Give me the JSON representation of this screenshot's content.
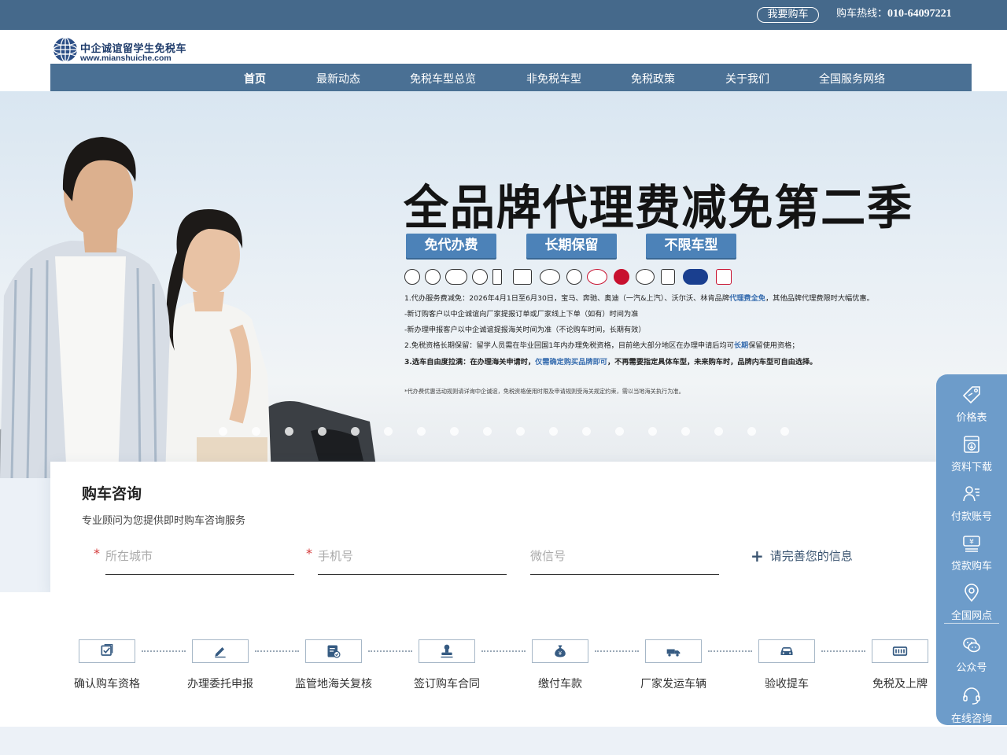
{
  "topbar": {
    "buy_label": "我要购车",
    "hotline_prefix": "购车热线：",
    "hotline_number": "010-64097221"
  },
  "logo": {
    "name": "中企诚谊留学生免税车",
    "url": "www.mianshuiche.com"
  },
  "nav": {
    "items": [
      {
        "label": "首页",
        "active": true
      },
      {
        "label": "最新动态"
      },
      {
        "label": "免税车型总览"
      },
      {
        "label": "非免税车型"
      },
      {
        "label": "免税政策"
      },
      {
        "label": "关于我们"
      },
      {
        "label": "全国服务网络"
      }
    ]
  },
  "banner": {
    "title": "全品牌代理费减免第二季",
    "tags": [
      "免代办费",
      "长期保留",
      "不限车型"
    ],
    "lines": [
      {
        "pre": "1.代办服务费减免：2026年4月1日至6月30日，宝马、奔驰、奥迪（一汽&上汽）、沃尔沃、林肯品牌",
        "em": "代理费全免",
        "post": "，其他品牌代理费限时大幅优惠。"
      },
      {
        "pre": "-新订购客户以中企诚谊向厂家提报订单或厂家线上下单（如有）时间为准",
        "em": "",
        "post": ""
      },
      {
        "pre": "-新办理申报客户以中企诚谊提报海关时间为准（不论购车时间，长期有效）",
        "em": "",
        "post": ""
      },
      {
        "pre": "2.免税资格长期保留：留学人员需在毕业回国1年内办理免税资格，目前绝大部分地区在办理申请后均可",
        "em": "长期",
        "post": "保留使用资格；"
      },
      {
        "pre": "3.选车自由度拉满：在办理海关申请时，",
        "em": "仅需确定购买品牌即可",
        "post": "，不再需要指定具体车型，未来购车时，品牌内车型可自由选择。"
      }
    ],
    "note": "*代办费优惠活动规则请详询中企诚谊，免税资格使用时限及申请规则受海关规定约束，需以当地海关执行为准。",
    "brand_icons": [
      "bmw-icon",
      "mercedes-icon",
      "audi-icon",
      "volvo-icon",
      "lincoln-icon",
      "cadillac-icon",
      "infiniti-icon",
      "volkswagen-icon",
      "toyota-icon",
      "mg-icon",
      "mazda-icon",
      "lexus-icon",
      "ford-icon",
      "honda-icon"
    ],
    "slide_count": 18,
    "active_slide": 0
  },
  "consult": {
    "title": "购车咨询",
    "subtitle": "专业顾问为您提供即时购车咨询服务",
    "city_placeholder": "所在城市",
    "phone_placeholder": "手机号",
    "wechat_placeholder": "微信号",
    "more_label": "请完善您的信息",
    "required_mark": "*"
  },
  "process": {
    "steps": [
      {
        "label": "确认购车资格",
        "icon": "checklist-icon"
      },
      {
        "label": "办理委托申报",
        "icon": "pen-icon"
      },
      {
        "label": "监管地海关复核",
        "icon": "document-check-icon"
      },
      {
        "label": "签订购车合同",
        "icon": "stamp-icon"
      },
      {
        "label": "缴付车款",
        "icon": "money-bag-icon"
      },
      {
        "label": "厂家发运车辆",
        "icon": "truck-icon"
      },
      {
        "label": "验收提车",
        "icon": "car-icon"
      },
      {
        "label": "免税及上牌",
        "icon": "license-plate-icon"
      }
    ]
  },
  "sidebar": {
    "items": [
      {
        "label": "价格表",
        "icon": "price-tag-icon"
      },
      {
        "label": "资料下载",
        "icon": "download-icon"
      },
      {
        "label": "付款账号",
        "icon": "account-icon"
      },
      {
        "label": "贷款购车",
        "icon": "loan-icon"
      },
      {
        "label": "全国网点",
        "icon": "location-icon"
      },
      {
        "label": "公众号",
        "icon": "wechat-icon"
      },
      {
        "label": "在线咨询",
        "icon": "headset-icon"
      }
    ]
  },
  "colors": {
    "topbar": "#45698b",
    "nav": "#4a7094",
    "tag": "#4c82b8",
    "sidebar": "#6d9cca",
    "required": "#d43a3a"
  }
}
